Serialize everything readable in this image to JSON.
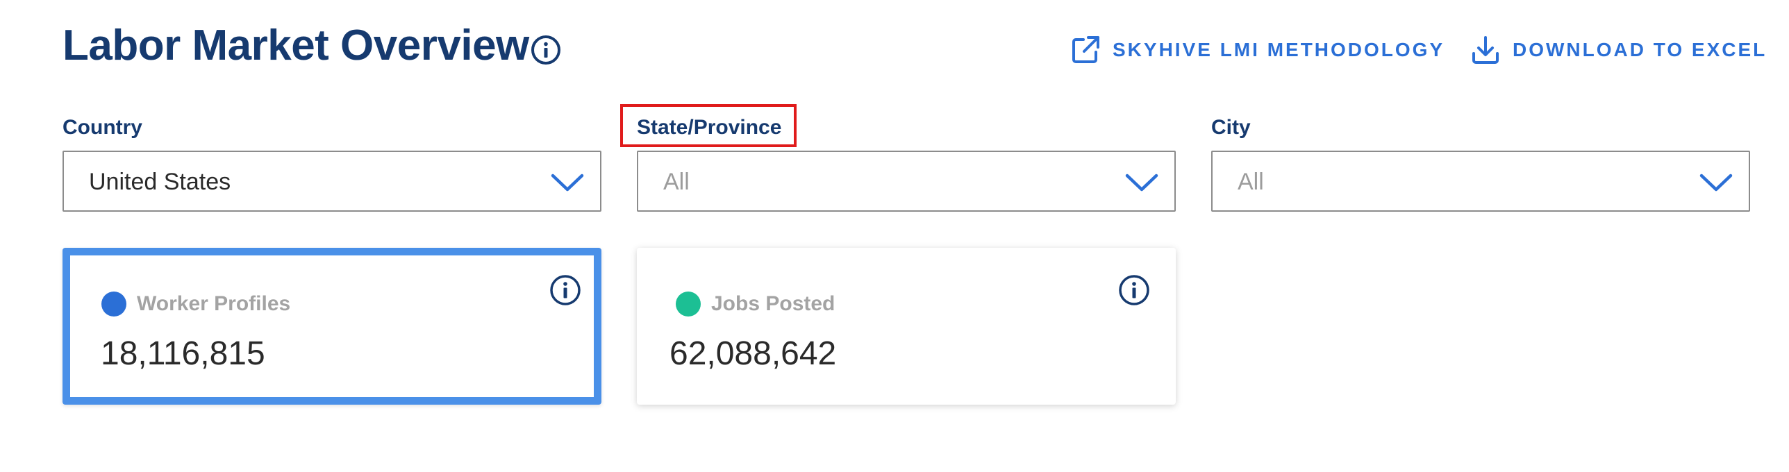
{
  "header": {
    "title": "Labor Market Overview",
    "title_info_icon": "info-circle-icon",
    "actions": [
      {
        "label": "SKYHIVE LMI METHODOLOGY",
        "icon": "external-link-icon"
      },
      {
        "label": "DOWNLOAD TO EXCEL",
        "icon": "download-icon"
      }
    ]
  },
  "filters": {
    "country": {
      "label": "Country",
      "value": "United States"
    },
    "state": {
      "label": "State/Province",
      "value": "All",
      "highlighted": true
    },
    "city": {
      "label": "City",
      "value": "All"
    }
  },
  "cards": [
    {
      "label": "Worker Profiles",
      "value": "18,116,815",
      "dot_color": "#2b6fd6",
      "selected": true
    },
    {
      "label": "Jobs Posted",
      "value": "62,088,642",
      "dot_color": "#1cbf94",
      "selected": false
    }
  ],
  "colors": {
    "title": "#163a6f",
    "accent": "#2b6fd6",
    "selected_border": "#4a90e8",
    "highlight": "#e01b1b"
  }
}
